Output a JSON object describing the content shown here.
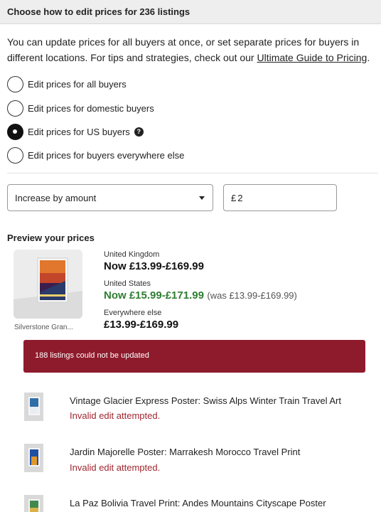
{
  "header": {
    "title": "Choose how to edit prices for 236 listings"
  },
  "intro": {
    "text": "You can update prices for all buyers at once, or set separate prices for buyers in different locations. For tips and strategies, check out our ",
    "link": "Ultimate Guide to Pricing",
    "suffix": "."
  },
  "radios": [
    {
      "label": "Edit prices for all buyers",
      "checked": false
    },
    {
      "label": "Edit prices for domestic buyers",
      "checked": false
    },
    {
      "label": "Edit prices for US buyers",
      "checked": true,
      "help_icon": "?"
    },
    {
      "label": "Edit prices for buyers everywhere else",
      "checked": false
    }
  ],
  "controls": {
    "mode_select": "Increase by amount",
    "amount_prefix": "£",
    "amount_value": "2"
  },
  "preview": {
    "heading": "Preview your prices",
    "listing_name": "Silverstone Gran...",
    "regions": [
      {
        "label": "United Kingdom",
        "price": "Now £13.99-£169.99"
      },
      {
        "label": "United States",
        "price": "Now £15.99-£171.99",
        "was": "(was £13.99-£169.99)"
      },
      {
        "label": "Everywhere else",
        "price": "£13.99-£169.99"
      }
    ]
  },
  "error_banner": {
    "text": "188 listings could not be updated"
  },
  "failed_listings": [
    {
      "title": "Vintage Glacier Express Poster: Swiss Alps Winter Train Travel Art",
      "error": "Invalid edit attempted."
    },
    {
      "title": "Jardin Majorelle Poster: Marrakesh Morocco Travel Print",
      "error": "Invalid edit attempted."
    },
    {
      "title": "La Paz Bolivia Travel Print: Andes Mountains Cityscape Poster",
      "error": ""
    }
  ],
  "colors": {
    "accent_green": "#2e7d32",
    "error_red": "#8e1b2c",
    "error_text": "#a0262f"
  }
}
